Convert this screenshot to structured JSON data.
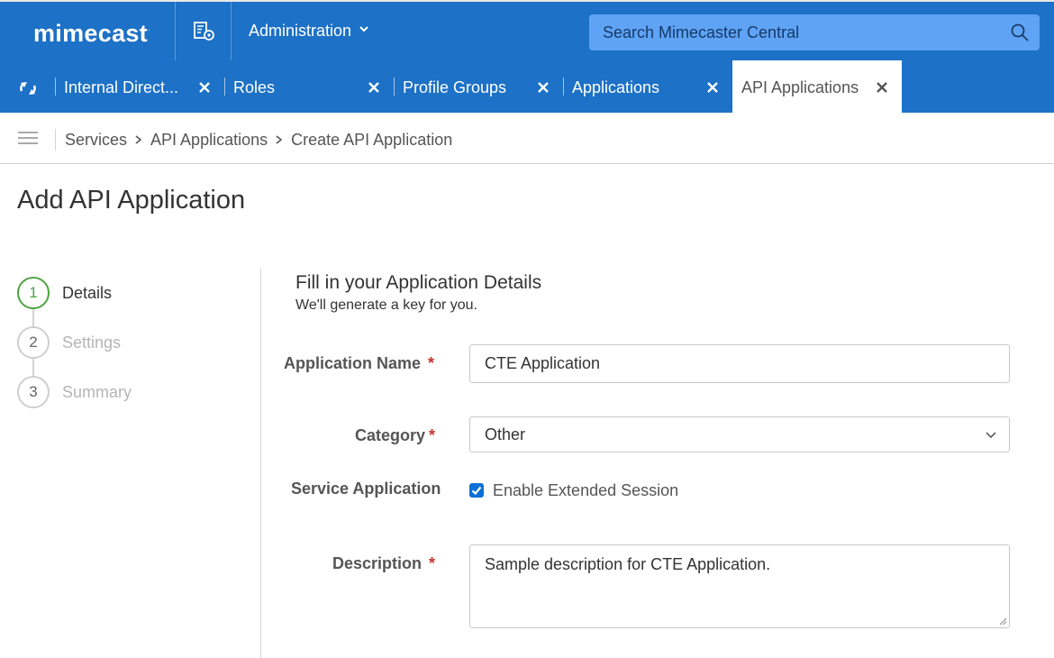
{
  "header": {
    "logo": "mimecast",
    "admin_menu_label": "Administration",
    "search_placeholder": "Search Mimecaster Central"
  },
  "tabs": [
    {
      "label": "Internal Direct...",
      "active": false
    },
    {
      "label": "Roles",
      "active": false
    },
    {
      "label": "Profile Groups",
      "active": false
    },
    {
      "label": "Applications",
      "active": false
    },
    {
      "label": "API Applications",
      "active": true
    }
  ],
  "breadcrumb": [
    "Services",
    "API Applications",
    "Create API Application"
  ],
  "page_title": "Add API Application",
  "steps": [
    {
      "number": "1",
      "label": "Details",
      "active": true
    },
    {
      "number": "2",
      "label": "Settings",
      "active": false
    },
    {
      "number": "3",
      "label": "Summary",
      "active": false
    }
  ],
  "form": {
    "title": "Fill in your Application Details",
    "subtitle": "We'll generate a key for you.",
    "application_name_label": "Application Name",
    "application_name_value": "CTE Application",
    "category_label": "Category",
    "category_value": "Other",
    "service_label": "Service Application",
    "service_checkbox_label": "Enable Extended Session",
    "service_checked": true,
    "description_label": "Description",
    "description_value": "Sample description for CTE Application.",
    "required_marker": "*"
  },
  "colors": {
    "header_blue": "#1d71c6",
    "search_bg": "#5fa3f5",
    "step_active": "#4ea342",
    "required": "#c9302c",
    "checkbox": "#0b6fd6"
  }
}
